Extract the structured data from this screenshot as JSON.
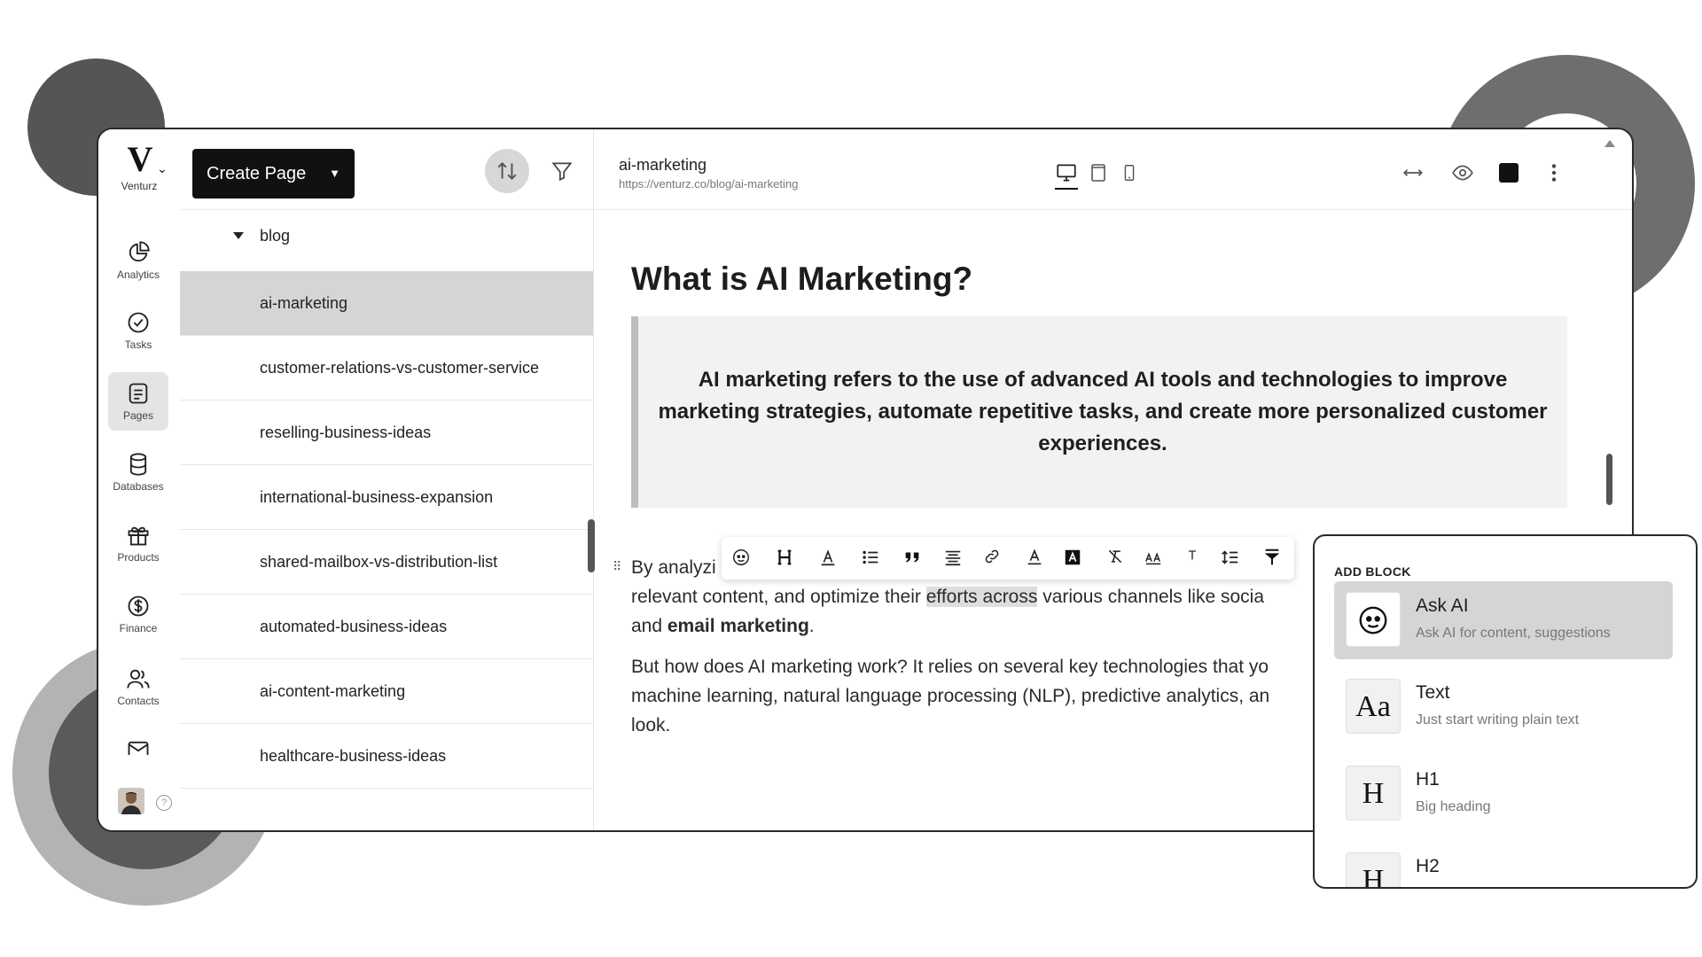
{
  "brand": {
    "name": "Venturz",
    "logo": "V"
  },
  "rail": {
    "items": [
      {
        "label": "Analytics",
        "icon": "analytics-icon"
      },
      {
        "label": "Tasks",
        "icon": "tasks-icon"
      },
      {
        "label": "Pages",
        "icon": "pages-icon",
        "active": true
      },
      {
        "label": "Databases",
        "icon": "databases-icon"
      },
      {
        "label": "Products",
        "icon": "products-icon"
      },
      {
        "label": "Finance",
        "icon": "finance-icon"
      },
      {
        "label": "Contacts",
        "icon": "contacts-icon"
      }
    ],
    "help": "?"
  },
  "pages_panel": {
    "create_label": "Create Page",
    "folder": "blog",
    "pages": [
      "ai-marketing",
      "customer-relations-vs-customer-service",
      "reselling-business-ideas",
      "international-business-expansion",
      "shared-mailbox-vs-distribution-list",
      "automated-business-ideas",
      "ai-content-marketing",
      "healthcare-business-ideas"
    ]
  },
  "editor": {
    "slug": "ai-marketing",
    "url": "https://venturz.co/blog/ai-marketing",
    "heading": "What is AI Marketing?",
    "callout": "AI marketing refers to the use of advanced AI tools and technologies to improve marketing strategies, automate repetitive tasks, and create more personalized customer experiences.",
    "para1": {
      "line1": "By analyzi",
      "line2_a": "relevant content, and optimize their ",
      "line2_highlight": "efforts across",
      "line2_b": " various channels like socia",
      "line3_a": "and ",
      "line3_bold": "email marketing",
      "line3_b": "."
    },
    "para2": {
      "line1": "But how does AI marketing work? It relies on several key technologies that yo",
      "line2": "machine learning, natural language processing (NLP), predictive analytics, an",
      "line3": "look."
    }
  },
  "add_block": {
    "title": "ADD BLOCK",
    "items": [
      {
        "name": "Ask AI",
        "desc": "Ask AI for content, suggestions",
        "icon": "smiley-icon"
      },
      {
        "name": "Text",
        "desc": "Just start writing plain text",
        "glyph": "Aa"
      },
      {
        "name": "H1",
        "desc": "Big heading",
        "glyph": "H"
      },
      {
        "name": "H2",
        "desc": "",
        "glyph": "H"
      }
    ]
  }
}
